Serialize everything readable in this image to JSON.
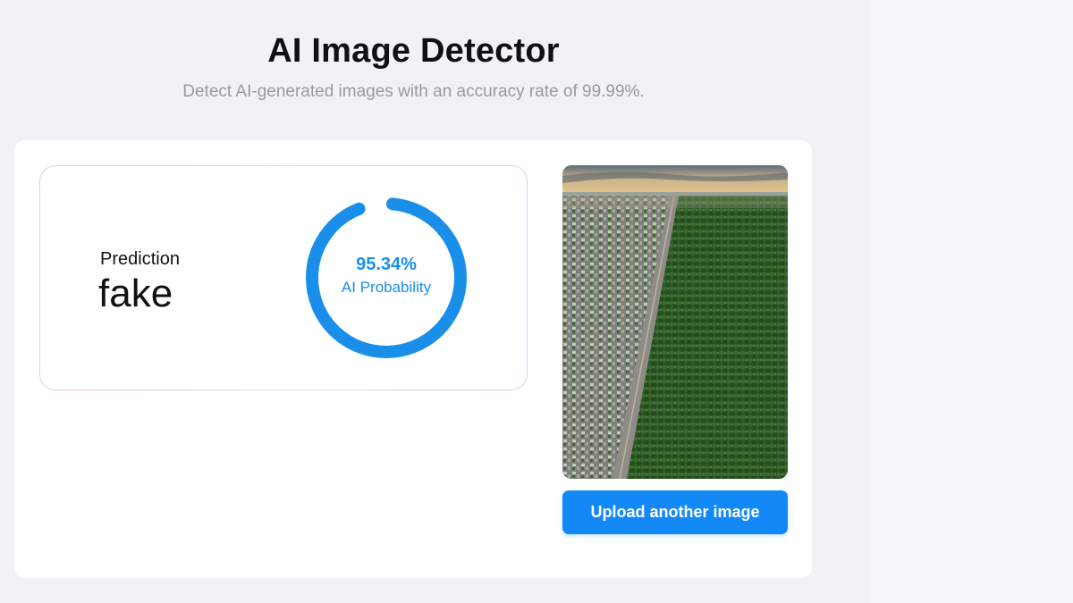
{
  "header": {
    "title": "AI Image Detector",
    "subtitle": "Detect AI-generated images with an accuracy rate of 99.99%."
  },
  "result": {
    "prediction_label": "Prediction",
    "prediction_value": "fake",
    "probability_text": "95.34%",
    "probability_fraction": 0.9534,
    "probability_caption": "AI Probability"
  },
  "image": {
    "description_icon": "aerial-city-forest-photo"
  },
  "actions": {
    "upload_label": "Upload another image"
  },
  "colors": {
    "accent": "#1389f8",
    "gauge": "#1a8fea",
    "background": "#f1f2f6"
  }
}
